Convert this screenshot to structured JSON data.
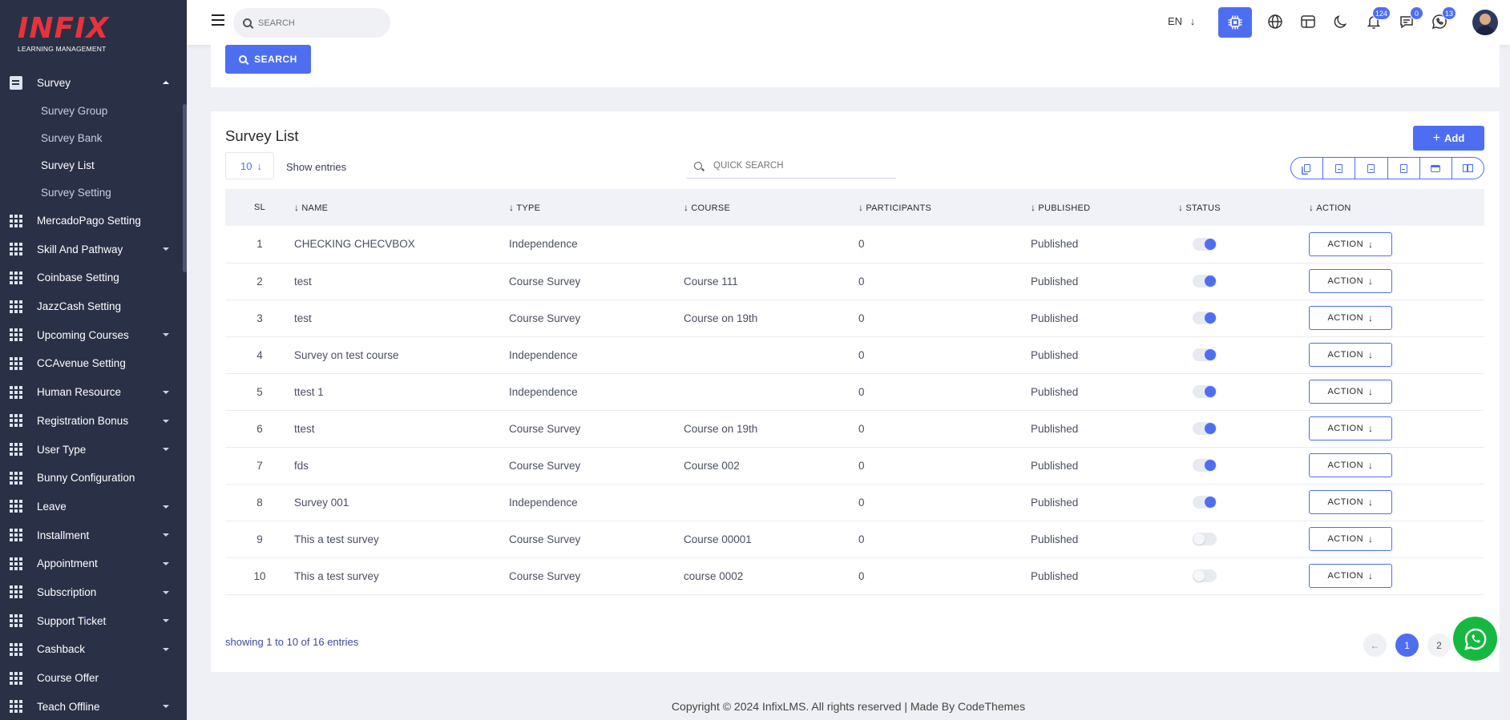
{
  "logo": {
    "main": "INFIX",
    "sub": "LEARNING MANAGEMENT"
  },
  "sidebar": {
    "active_group": {
      "label": "Survey",
      "icon": "document-icon"
    },
    "sub_items": [
      {
        "label": "Survey Group",
        "active": false
      },
      {
        "label": "Survey Bank",
        "active": false
      },
      {
        "label": "Survey List",
        "active": true
      },
      {
        "label": "Survey Setting",
        "active": false
      }
    ],
    "items": [
      {
        "label": "MercadoPago Setting",
        "has_caret": false
      },
      {
        "label": "Skill And Pathway",
        "has_caret": true
      },
      {
        "label": "Coinbase Setting",
        "has_caret": false
      },
      {
        "label": "JazzCash Setting",
        "has_caret": false
      },
      {
        "label": "Upcoming Courses",
        "has_caret": true
      },
      {
        "label": "CCAvenue Setting",
        "has_caret": false
      },
      {
        "label": "Human Resource",
        "has_caret": true
      },
      {
        "label": "Registration Bonus",
        "has_caret": true
      },
      {
        "label": "User Type",
        "has_caret": true
      },
      {
        "label": "Bunny Configuration",
        "has_caret": false
      },
      {
        "label": "Leave",
        "has_caret": true
      },
      {
        "label": "Installment",
        "has_caret": true
      },
      {
        "label": "Appointment",
        "has_caret": true
      },
      {
        "label": "Subscription",
        "has_caret": true
      },
      {
        "label": "Support Ticket",
        "has_caret": true
      },
      {
        "label": "Cashback",
        "has_caret": true
      },
      {
        "label": "Course Offer",
        "has_caret": false
      },
      {
        "label": "Teach Offline",
        "has_caret": true
      }
    ]
  },
  "topbar": {
    "search_placeholder": "SEARCH",
    "language": "EN",
    "notifications_count": "124",
    "messages_count": "0",
    "whatsapp_count": "13"
  },
  "top_card": {
    "search_button": "SEARCH"
  },
  "survey_list": {
    "title": "Survey List",
    "add_button": "Add",
    "entries_value": "10",
    "show_entries_label": "Show entries",
    "quick_search_placeholder": "QUICK SEARCH",
    "columns": [
      "SL",
      "NAME",
      "TYPE",
      "COURSE",
      "PARTICIPANTS",
      "PUBLISHED",
      "STATUS",
      "ACTION"
    ],
    "action_label": "ACTION",
    "rows": [
      {
        "sl": "1",
        "name": "CHECKING CHECVBOX",
        "type": "Independence",
        "course": "",
        "participants": "0",
        "published": "Published",
        "status": true
      },
      {
        "sl": "2",
        "name": "test",
        "type": "Course Survey",
        "course": "Course 111",
        "participants": "0",
        "published": "Published",
        "status": true
      },
      {
        "sl": "3",
        "name": "test",
        "type": "Course Survey",
        "course": "Course on 19th",
        "participants": "0",
        "published": "Published",
        "status": true
      },
      {
        "sl": "4",
        "name": "Survey on test course",
        "type": "Independence",
        "course": "",
        "participants": "0",
        "published": "Published",
        "status": true
      },
      {
        "sl": "5",
        "name": "ttest 1",
        "type": "Independence",
        "course": "",
        "participants": "0",
        "published": "Published",
        "status": true
      },
      {
        "sl": "6",
        "name": "ttest",
        "type": "Course Survey",
        "course": "Course on 19th",
        "participants": "0",
        "published": "Published",
        "status": true
      },
      {
        "sl": "7",
        "name": "fds",
        "type": "Course Survey",
        "course": "Course 002",
        "participants": "0",
        "published": "Published",
        "status": true
      },
      {
        "sl": "8",
        "name": "Survey 001",
        "type": "Independence",
        "course": "",
        "participants": "0",
        "published": "Published",
        "status": true
      },
      {
        "sl": "9",
        "name": "This a test survey",
        "type": "Course Survey",
        "course": "Course 00001",
        "participants": "0",
        "published": "Published",
        "status": false
      },
      {
        "sl": "10",
        "name": "This a test survey",
        "type": "Course Survey",
        "course": "course 0002",
        "participants": "0",
        "published": "Published",
        "status": false
      }
    ],
    "showing_text": "showing 1 to 10 of 16 entries",
    "pages": [
      "1",
      "2"
    ],
    "current_page": "1"
  },
  "footer": {
    "text": "Copyright © 2024 InfixLMS. All rights reserved | Made By CodeThemes"
  },
  "colors": {
    "primary": "#4e6ef2",
    "sidebar_bg": "#2a3046",
    "logo_red": "#e8323c",
    "whatsapp": "#17b841"
  }
}
